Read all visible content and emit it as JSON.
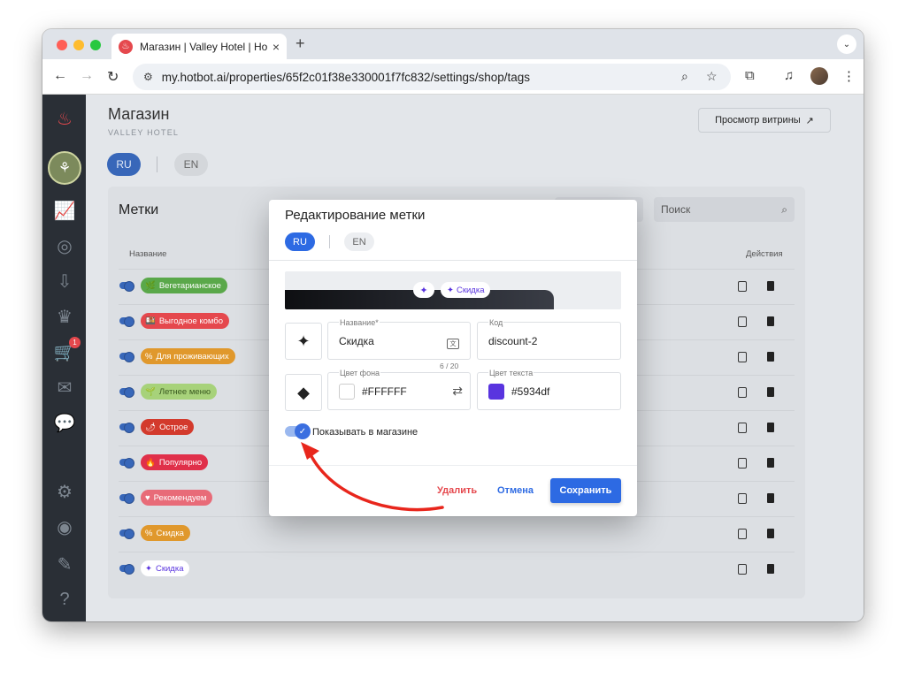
{
  "browser": {
    "tab_title": "Магазин | Valley Hotel | Hotbot",
    "url": "my.hotbot.ai/properties/65f2c01f38e330001f7fc832/settings/shop/tags",
    "traffic_lights": [
      "#ff5f57",
      "#febc2e",
      "#28c840"
    ]
  },
  "sidebar": {
    "icons": [
      "flame-logo-icon",
      "analytics-icon",
      "tasks-icon",
      "inbox-icon",
      "crown-icon",
      "cart-icon",
      "mail-icon",
      "chat-icon",
      "settings-icon",
      "profile-icon",
      "pencil-icon",
      "help-icon"
    ],
    "cart_badge": "1"
  },
  "header": {
    "title": "Магазин",
    "subtitle": "VALLEY HOTEL",
    "preview_button": "Просмотр витрины",
    "lang_ru": "RU",
    "lang_en": "EN"
  },
  "tags_card": {
    "title": "Метки",
    "search_placeholder": "Поиск",
    "col_name": "Название",
    "col_actions": "Действия",
    "rows": [
      {
        "label": "Вегетарианское",
        "icon": "🌿",
        "bg": "#5aa84a",
        "fg": "#ffffff"
      },
      {
        "label": "Выгодное комбо",
        "icon": "🍱",
        "bg": "#e5484d",
        "fg": "#ffffff"
      },
      {
        "label": "Для проживающих",
        "icon": "%",
        "bg": "#e0982c",
        "fg": "#ffffff"
      },
      {
        "label": "Летнее меню",
        "icon": "🌱",
        "bg": "#a7d27a",
        "fg": "#3a5a20"
      },
      {
        "label": "Острое",
        "icon": "🌶",
        "bg": "#d33a2c",
        "fg": "#ffffff"
      },
      {
        "label": "Популярно",
        "icon": "🔥",
        "bg": "#e0304a",
        "fg": "#ffffff"
      },
      {
        "label": "Рекомендуем",
        "icon": "♥",
        "bg": "#e86b78",
        "fg": "#ffffff"
      },
      {
        "label": "Скидка",
        "icon": "%",
        "bg": "#e0982c",
        "fg": "#ffffff"
      },
      {
        "label": "Скидка",
        "icon": "✦",
        "bg": "#ffffff",
        "fg": "#5934df"
      }
    ]
  },
  "modal": {
    "title": "Редактирование метки",
    "lang_ru": "RU",
    "lang_en": "EN",
    "preview_label": "Скидка",
    "name_label": "Название*",
    "name_value": "Скидка",
    "name_counter": "6 / 20",
    "code_label": "Код",
    "code_value": "discount-2",
    "bg_color_label": "Цвет фона",
    "bg_color_value": "#FFFFFF",
    "text_color_label": "Цвет текста",
    "text_color_value": "#5934df",
    "show_in_shop_label": "Показывать в магазине",
    "show_in_shop": true,
    "delete_button": "Удалить",
    "cancel_button": "Отмена",
    "save_button": "Сохранить"
  },
  "colors": {
    "accent": "#2d6ae3",
    "danger": "#e5484d",
    "annotation_arrow": "#e8261c"
  }
}
